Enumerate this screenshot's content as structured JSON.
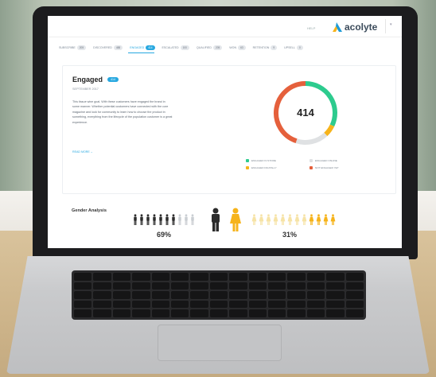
{
  "header": {
    "help_label": "HELP",
    "brand_name": "acolyte",
    "brand_colors": [
      "#1e9bd7",
      "#f6b31a"
    ]
  },
  "tabs": [
    {
      "label": "SUBSCRIBE",
      "count": "205"
    },
    {
      "label": "DISCOVERED",
      "count": "488"
    },
    {
      "label": "ENGAGED",
      "count": "414",
      "active": true
    },
    {
      "label": "ESCALATED",
      "count": "100"
    },
    {
      "label": "QUALIFIED",
      "count": "205"
    },
    {
      "label": "WON",
      "count": "63"
    },
    {
      "label": "RETENTION",
      "count": "9"
    },
    {
      "label": "UPSELL",
      "count": "0"
    }
  ],
  "card": {
    "title": "Engaged",
    "badge": "414",
    "subtitle": "SEPTEMBER 2017",
    "description": "This tissue wine goal. With these customers have engaged the brand in some manner. Whether potential customers have connected with the core magazine and look for community to learn how to choose the product in something, everything from the lifecycle of the population customer is a great experience.",
    "read_more": "READ MORE"
  },
  "chart_data": {
    "type": "pie",
    "center_value": "414",
    "series": [
      {
        "name": "ENGAGED IN STORE",
        "value": 32,
        "color": "#2dcb8e"
      },
      {
        "name": "ENGAGED DIGITALLY",
        "value": 6,
        "color": "#f6b31a"
      },
      {
        "name": "ENGAGED ONLINE",
        "value": 17,
        "color": "#dfe1e3"
      },
      {
        "name": "NOT ENGAGED YET",
        "value": 45,
        "color": "#e5603c"
      }
    ]
  },
  "legend": [
    {
      "label": "ENGAGED IN STORE",
      "color": "#2dcb8e"
    },
    {
      "label": "ENGAGED ONLINE",
      "color": "#dfe1e3"
    },
    {
      "label": "ENGAGED DIGITALLY",
      "color": "#f6b31a"
    },
    {
      "label": "NOT ENGAGED YET",
      "color": "#e5603c"
    }
  ],
  "gender": {
    "title": "Gender Analysis",
    "male_pct": "69%",
    "female_pct": "31%",
    "male_color": "#2b2b2b",
    "female_color": "#f6b31a"
  }
}
